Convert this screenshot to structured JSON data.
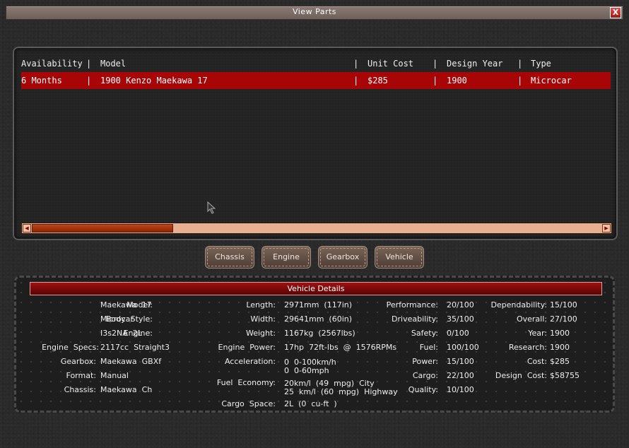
{
  "window": {
    "title": "View  Parts",
    "close_label": "X"
  },
  "table": {
    "headers": [
      "Availability",
      "Model",
      "Unit Cost",
      "Design Year",
      "Type"
    ],
    "separator": "|",
    "rows": [
      [
        "6 Months",
        "1900 Kenzo Maekawa 17",
        "$285",
        "1900",
        "Microcar"
      ]
    ],
    "selected_row": 0
  },
  "scrollbar": {
    "left_arrow": "◀",
    "right_arrow": "▶",
    "position": 0.0
  },
  "tabs": [
    "Chassis",
    "Engine",
    "Gearbox",
    "Vehicle"
  ],
  "details": {
    "title": "Vehicle Details",
    "col1": [
      {
        "label": "Model:",
        "value": "Maekawa  17"
      },
      {
        "label": "Body  Style:",
        "value": "Microcar"
      },
      {
        "label": "Engine:",
        "value": "I3s2NA  2L"
      },
      {
        "label": "Engine  Specs:",
        "value": "2117cc  Straight3"
      },
      {
        "label": "Gearbox:",
        "value": "Maekawa  GBXf"
      },
      {
        "label": "Format:",
        "value": "Manual"
      },
      {
        "label": "Chassis:",
        "value": "Maekawa  Ch"
      }
    ],
    "col2": [
      {
        "label": "Length:",
        "value": "2971mm  (117in)"
      },
      {
        "label": "Width:",
        "value": "29641mm  (60in)"
      },
      {
        "label": "Weight:",
        "value": "1167kg  (2567lbs)"
      },
      {
        "label": "Engine  Power:",
        "value": "17hp  72ft-lbs  @  1576RPMs"
      },
      {
        "label": "Acceleration:",
        "value": "0  0-100km/h",
        "value2": "0  0-60mph"
      },
      {
        "label": "Fuel  Economy:",
        "value": "20km/l  (49  mpg)  City",
        "value2": "25  km/l  (60  mpg)  Highway"
      },
      {
        "label": "Cargo  Space:",
        "value": "2L  (0  cu-ft  )"
      }
    ],
    "col3": [
      {
        "label": "Performance:",
        "value": "20/100"
      },
      {
        "label": "Driveability:",
        "value": "35/100"
      },
      {
        "label": "Safety:",
        "value": "0/100"
      },
      {
        "label": "Fuel:",
        "value": "100/100"
      },
      {
        "label": "Power:",
        "value": "15/100"
      },
      {
        "label": "Cargo:",
        "value": "22/100"
      },
      {
        "label": "Quality:",
        "value": "10/100"
      }
    ],
    "col4": [
      {
        "label": "Dependability:",
        "value": "15/100"
      },
      {
        "label": "Overall:",
        "value": "27/100"
      },
      {
        "label": "Year:",
        "value": "1900"
      },
      {
        "label": "Research:",
        "value": "1900"
      },
      {
        "label": "Cost:",
        "value": "$285"
      },
      {
        "label": "Design  Cost:",
        "value": "$58755"
      }
    ]
  }
}
